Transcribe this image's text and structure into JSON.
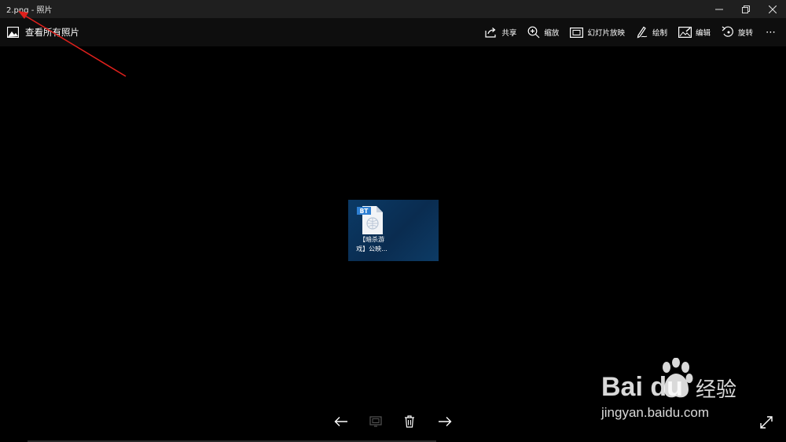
{
  "window": {
    "title": "2.png - 照片",
    "controls": [
      "minimize-icon",
      "restore-icon",
      "close-icon"
    ]
  },
  "toolbar": {
    "see_all": "查看所有照片",
    "tools": [
      {
        "label": "共享",
        "icon": "share-icon"
      },
      {
        "label": "缩放",
        "icon": "zoom-icon"
      },
      {
        "label": "幻灯片放映",
        "icon": "slideshow-icon"
      },
      {
        "label": "绘制",
        "icon": "draw-icon"
      },
      {
        "label": "编辑",
        "icon": "edit-icon"
      },
      {
        "label": "旋转",
        "icon": "rotate-icon"
      }
    ],
    "more": "⋯"
  },
  "image": {
    "file_badge": "BT",
    "file_label_line1": "【暗杀游",
    "file_label_line2": "戏】公映..."
  },
  "bottom_bar": {
    "icons": [
      "previous-arrow-icon",
      "slideshow-small-icon",
      "delete-icon",
      "next-arrow-icon"
    ],
    "fullscreen_icon": "fullscreen-icon"
  },
  "watermark": {
    "logo": "Bai du",
    "cn": "经验",
    "url": "jingyan.baidu.com"
  },
  "colors": {
    "titlebar": "#1f1f1f",
    "toolbar": "#0e0e0e",
    "background": "#000000",
    "annotation_arrow": "#e0201c"
  }
}
